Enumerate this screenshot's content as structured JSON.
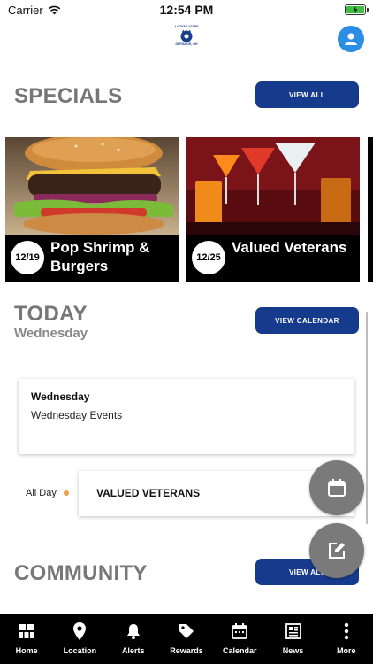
{
  "status_bar": {
    "carrier": "Carrier",
    "time": "12:54 PM"
  },
  "header": {
    "logo_top": "LODGE #2399",
    "logo_bottom": "DEFIANCE, OH"
  },
  "specials": {
    "title": "SPECIALS",
    "view_all_label": "VIEW ALL",
    "cards": [
      {
        "date": "12/19",
        "title": "Pop Shrimp & Burgers",
        "image": "burger-photo"
      },
      {
        "date": "12/25",
        "title": "Valued Veterans",
        "image": "cocktails-photo"
      }
    ]
  },
  "today": {
    "title": "TODAY",
    "subtitle": "Wednesday",
    "view_calendar_label": "VIEW CALENDAR",
    "event_card": {
      "day": "Wednesday",
      "description": "Wednesday Events"
    },
    "all_day": {
      "label": "All Day",
      "title": "VALUED VETERANS"
    }
  },
  "community": {
    "title": "COMMUNITY",
    "view_all_label": "VIEW ALL"
  },
  "fabs": [
    {
      "icon": "calendar-icon"
    },
    {
      "icon": "edit-icon"
    }
  ],
  "tabs": [
    {
      "label": "Home",
      "icon": "home-grid-icon"
    },
    {
      "label": "Location",
      "icon": "location-pin-icon"
    },
    {
      "label": "Alerts",
      "icon": "bell-icon"
    },
    {
      "label": "Rewards",
      "icon": "tag-icon"
    },
    {
      "label": "Calendar",
      "icon": "calendar-icon"
    },
    {
      "label": "News",
      "icon": "news-icon"
    },
    {
      "label": "More",
      "icon": "more-dots-icon"
    }
  ],
  "colors": {
    "accent_blue": "#163b8c",
    "profile_blue": "#2b8de3",
    "dot_orange": "#f0a040",
    "fab_gray": "#7a7a7a"
  }
}
